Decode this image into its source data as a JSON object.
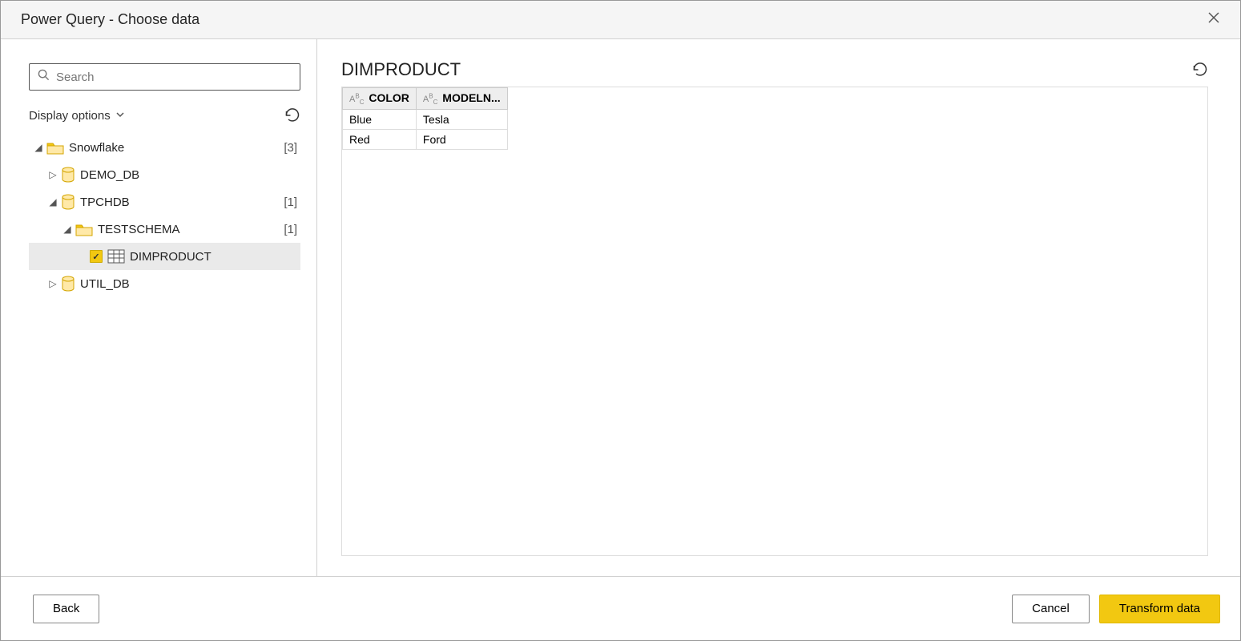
{
  "header": {
    "title": "Power Query - Choose data"
  },
  "search": {
    "placeholder": "Search"
  },
  "display_options_label": "Display options",
  "tree": {
    "root": {
      "label": "Snowflake",
      "count": "[3]"
    },
    "items": [
      {
        "label": "DEMO_DB"
      },
      {
        "label": "TPCHDB",
        "count": "[1]"
      },
      {
        "label": "TESTSCHEMA",
        "count": "[1]"
      },
      {
        "label": "DIMPRODUCT"
      },
      {
        "label": "UTIL_DB"
      }
    ]
  },
  "preview": {
    "title": "DIMPRODUCT",
    "columns": [
      "COLOR",
      "MODELN..."
    ],
    "rows": [
      {
        "c0": "Blue",
        "c1": "Tesla"
      },
      {
        "c0": "Red",
        "c1": "Ford"
      }
    ]
  },
  "buttons": {
    "back": "Back",
    "cancel": "Cancel",
    "transform": "Transform data"
  }
}
